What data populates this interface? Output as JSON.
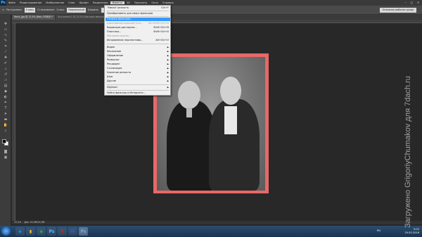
{
  "menubar": {
    "logo": "Ps",
    "items": [
      "Файл",
      "Редактирование",
      "Изображение",
      "Слои",
      "Шрифт",
      "Выделение",
      "Фильтр",
      "3D",
      "Просмотр",
      "Окно",
      "Справка"
    ],
    "win_controls": [
      "–",
      "□",
      "✕"
    ]
  },
  "options": {
    "feather_label": "Растушевка:",
    "feather_value": "0 пикс",
    "antialias": "Сглаживание",
    "style_label": "Стиль:",
    "style_value": "Нормальный",
    "width_label": "Ширина:",
    "height_label": "Высота:",
    "refine": "Уточн. край...",
    "workspace": "Основная рабочая среда"
  },
  "tabs": [
    "Фото_jpg @ 12,5% (Фон, RGB/8) *",
    "Без имени-1 @ 12,5% (Выгоркa минуса/8)"
  ],
  "filter_menu": {
    "last_filter": "\"Умная\" резкость",
    "last_filter_shortcut": "Ctrl+F",
    "convert_smart": "Преобразовать для смарт-фильтров",
    "gallery": "Галерея фильтров...",
    "adaptive_wide": "Адаптивный широкий угол...",
    "adaptive_wide_shortcut": "Alt+Shift+Ctrl+A",
    "lens_correction": "Коррекция дисторсии...",
    "lens_correction_shortcut": "Shift+Ctrl+R",
    "liquify": "Пластика...",
    "liquify_shortcut": "Shift+Ctrl+X",
    "oil_paint": "Масляная краска...",
    "vanishing_point": "Исправление перспективы...",
    "vanishing_point_shortcut": "Alt+Ctrl+V",
    "submenus": [
      "Видео",
      "Искажение",
      "Оформление",
      "Размытие",
      "Рендеринг",
      "Стилизация",
      "Усиление резкости",
      "Шум",
      "Другие"
    ],
    "digimarc": "Digimarc",
    "browse_online": "Найти фильтры в Интернете..."
  },
  "status": {
    "zoom": "12,5%",
    "doc": "Док: 24,9M/24,9M"
  },
  "taskbar": {
    "apps": [
      {
        "glyph": "e",
        "color": "#1e90ff"
      },
      {
        "glyph": "▮",
        "color": "#f0c040"
      },
      {
        "glyph": "◉",
        "color": "#2aa84a"
      },
      {
        "glyph": "Ps",
        "color": "#5ab4ff"
      },
      {
        "glyph": "Y",
        "color": "#e02020"
      },
      {
        "glyph": "W",
        "color": "#2b5fb8"
      },
      {
        "glyph": "Ps",
        "color": "#5ab4ff"
      }
    ],
    "lang": "RU",
    "time": "0:02",
    "date": "29.03.2016"
  },
  "watermark": "Загружено GrigoriyChumakov для 7dach.ru"
}
